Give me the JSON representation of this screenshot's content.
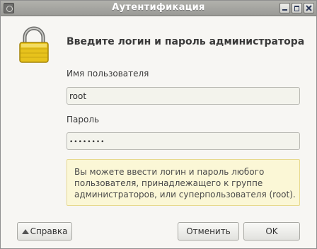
{
  "window": {
    "title": "Аутентификация",
    "controls": [
      "minimize-icon",
      "maximize-icon",
      "close-icon"
    ]
  },
  "dialog": {
    "heading": "Введите логин и пароль администратора",
    "icon": "lock-icon",
    "username": {
      "label": "Имя пользователя",
      "value": "root"
    },
    "password": {
      "label": "Пароль",
      "value": "••••••••"
    },
    "info_lines": [
      "Вы можете ввести логин и пароль любого",
      "пользователя, принадлежащего к группе",
      "администраторов, или суперпользователя (root)."
    ]
  },
  "buttons": {
    "help": "Справка",
    "cancel": "Отменить",
    "ok": "OK"
  },
  "colors": {
    "titlebar": "#a6a6a2",
    "info_bg": "#fbf7d6",
    "info_border": "#e7d98e",
    "lock_gold": "#e7c21c"
  }
}
